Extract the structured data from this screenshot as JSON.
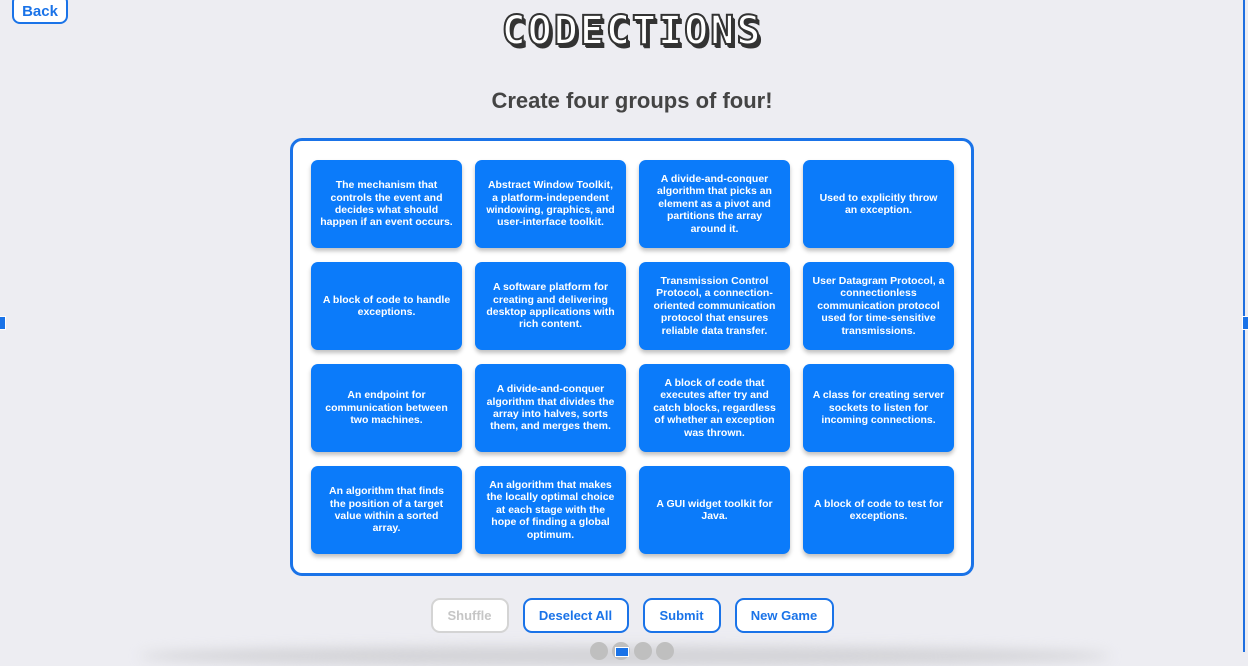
{
  "nav": {
    "back_label": "Back"
  },
  "header": {
    "logo_text": "CODECTIONS",
    "instructions": "Create four groups of four!"
  },
  "board": {
    "cards": [
      "The mechanism that controls the event and decides what should happen if an event occurs.",
      "Abstract Window Toolkit, a platform-independent windowing, graphics, and user-interface toolkit.",
      "A divide-and-conquer algorithm that picks an element as a pivot and partitions the array around it.",
      "Used to explicitly throw an exception.",
      "A block of code to handle exceptions.",
      "A software platform for creating and delivering desktop applications with rich content.",
      "Transmission Control Protocol, a connection-oriented communication protocol that ensures reliable data transfer.",
      "User Datagram Protocol, a connectionless communication protocol used for time-sensitive transmissions.",
      "An endpoint for communication between two machines.",
      "A divide-and-conquer algorithm that divides the array into halves, sorts them, and merges them.",
      "A block of code that executes after try and catch blocks, regardless of whether an exception was thrown.",
      "A class for creating server sockets to listen for incoming connections.",
      "An algorithm that finds the position of a target value within a sorted array.",
      "An algorithm that makes the locally optimal choice at each stage with the hope of finding a global optimum.",
      "A GUI widget toolkit for Java.",
      "A block of code to test for exceptions."
    ]
  },
  "controls": {
    "shuffle_label": "Shuffle",
    "shuffle_state": "disabled",
    "deselect_label": "Deselect All",
    "submit_label": "Submit",
    "new_game_label": "New Game"
  },
  "colors": {
    "accent": "#1a73e8",
    "card": "#0b7bfa",
    "background": "#ededf2"
  }
}
